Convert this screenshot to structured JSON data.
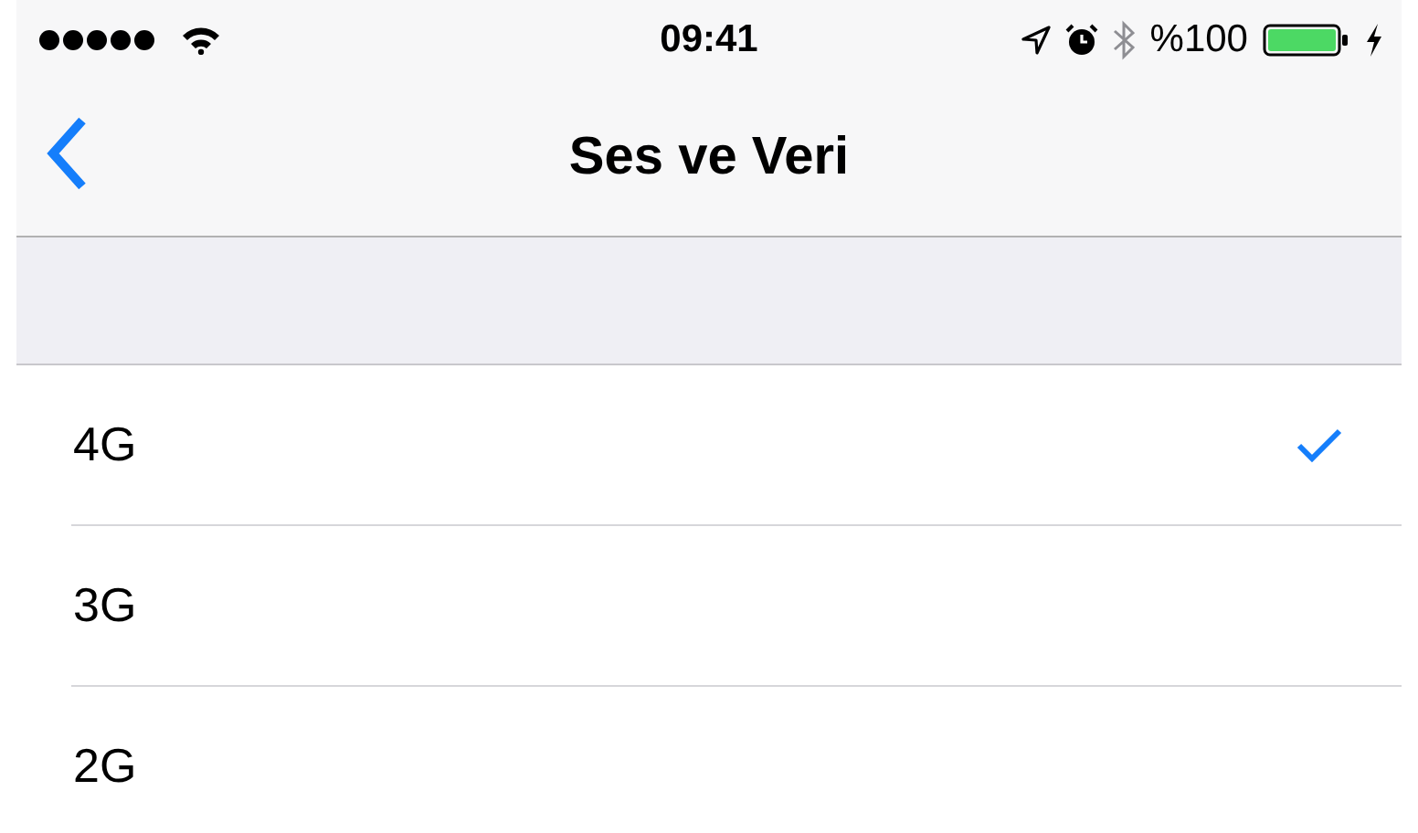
{
  "status_bar": {
    "time": "09:41",
    "battery_text": "%100"
  },
  "nav_bar": {
    "title": "Ses ve Veri"
  },
  "options": [
    {
      "label": "4G",
      "selected": true
    },
    {
      "label": "3G",
      "selected": false
    },
    {
      "label": "2G",
      "selected": false
    }
  ]
}
